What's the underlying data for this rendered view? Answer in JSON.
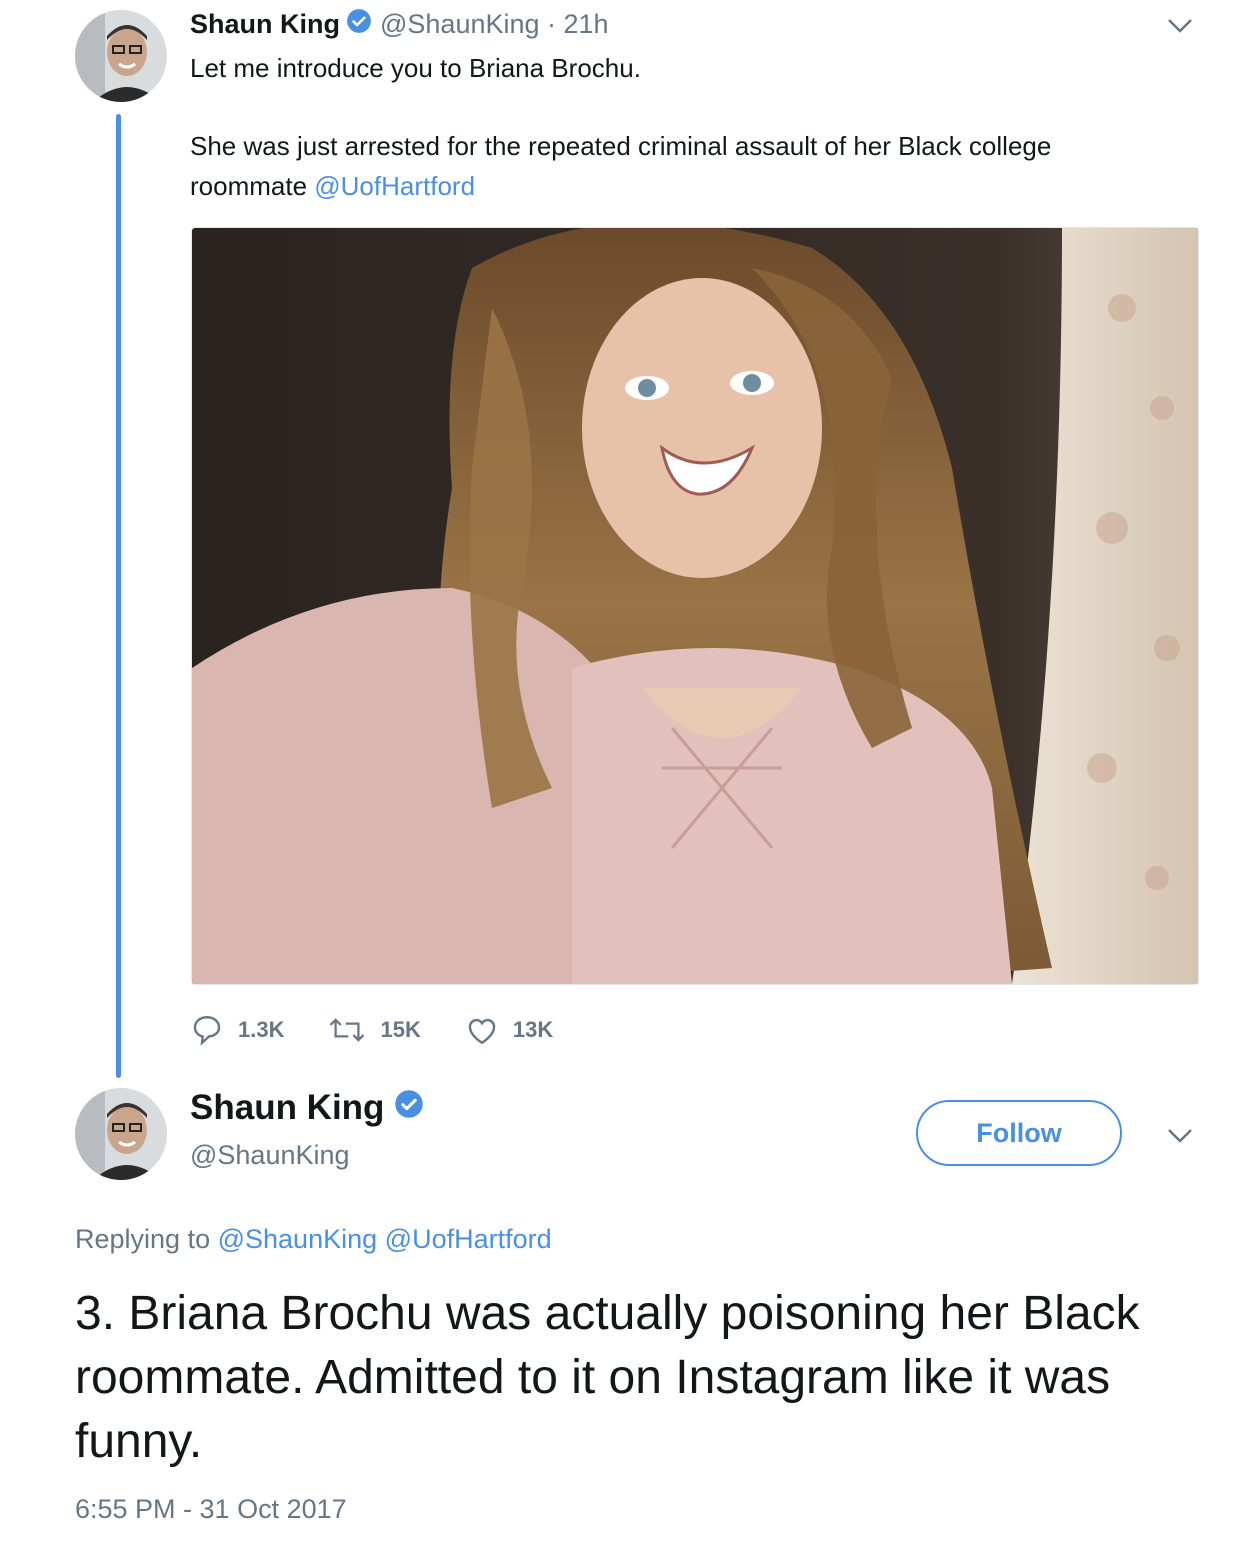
{
  "colors": {
    "link": "#4a90e2",
    "text": "#14171a",
    "muted": "#657786",
    "thread_line": "#4a90e2",
    "verified": "#4a90e2"
  },
  "tweet1": {
    "display_name": "Shaun King",
    "handle_time": "@ShaunKing · 21h",
    "line1": "Let me introduce you to Briana Brochu.",
    "para2_line1": "She was just arrested for the repeated criminal assault of her Black college",
    "para2_line2_prefix": "roommate ",
    "mention": "@UofHartford",
    "actions": {
      "replies": "1.3K",
      "retweets": "15K",
      "likes": "13K"
    },
    "icons": [
      "reply-icon",
      "retweet-icon",
      "like-icon",
      "chevron-down-icon",
      "verified-icon"
    ]
  },
  "tweet2": {
    "display_name": "Shaun King",
    "handle": "@ShaunKing",
    "follow_label": "Follow",
    "replying_prefix": "Replying to",
    "reply_mention_1": "@ShaunKing",
    "reply_mention_2": "@UofHartford",
    "text": "3. Briana Brochu was actually poisoning her Black roommate. Admitted to it on Instagram like it was funny.",
    "timestamp": "6:55 PM - 31 Oct 2017"
  }
}
